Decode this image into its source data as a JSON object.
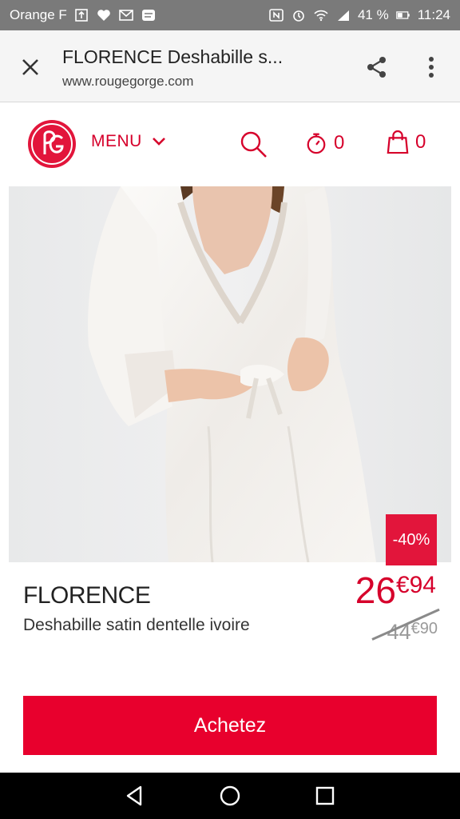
{
  "status_bar": {
    "carrier": "Orange F",
    "battery": "41 %",
    "time": "11:24"
  },
  "browser": {
    "title": "FLORENCE Deshabille s...",
    "url": "www.rougegorge.com"
  },
  "header": {
    "menu_label": "MENU",
    "timer_count": "0",
    "cart_count": "0"
  },
  "product": {
    "discount": "-40%",
    "brand": "FLORENCE",
    "description": "Deshabille satin dentelle ivoire",
    "price_int": "26",
    "price_dec": "€94",
    "old_price_int": "44",
    "old_price_dec": "€90",
    "buy_label": "Achetez"
  },
  "colors": {
    "brand_red": "#d6002b",
    "button_red": "#e8002d",
    "badge_red": "#e2153b"
  }
}
